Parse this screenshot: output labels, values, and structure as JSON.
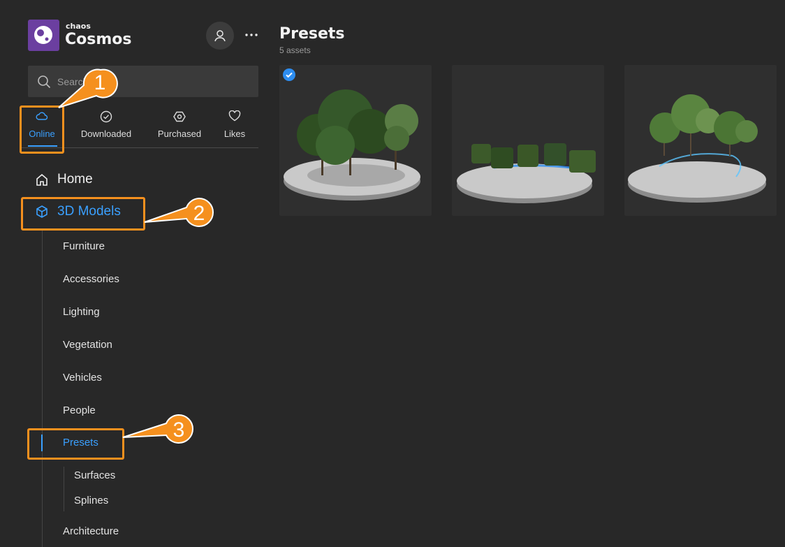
{
  "brand": {
    "top": "chaos",
    "name": "Cosmos"
  },
  "search": {
    "placeholder": "Search"
  },
  "tabs": [
    {
      "label": "Online",
      "icon": "cloud-icon",
      "active": true
    },
    {
      "label": "Downloaded",
      "icon": "check-circle-icon"
    },
    {
      "label": "Purchased",
      "icon": "hexagon-icon"
    },
    {
      "label": "Likes",
      "icon": "heart-icon"
    }
  ],
  "nav": {
    "home": "Home",
    "models": "3D Models",
    "categories": [
      "Furniture",
      "Accessories",
      "Lighting",
      "Vegetation",
      "Vehicles",
      "People",
      "Presets",
      "Architecture"
    ],
    "presets_children": [
      "Surfaces",
      "Splines"
    ]
  },
  "main": {
    "title": "Presets",
    "count": "5 assets",
    "cards": [
      {
        "selected": true,
        "subject": "tree-group"
      },
      {
        "selected": false,
        "subject": "hedges"
      },
      {
        "selected": false,
        "subject": "trees-spline"
      }
    ]
  },
  "callouts": [
    "1",
    "2",
    "3"
  ],
  "colors": {
    "accent": "#3aa0ff",
    "highlight": "#f5901e",
    "brand": "#6b3fa0",
    "bg": "#282828"
  }
}
